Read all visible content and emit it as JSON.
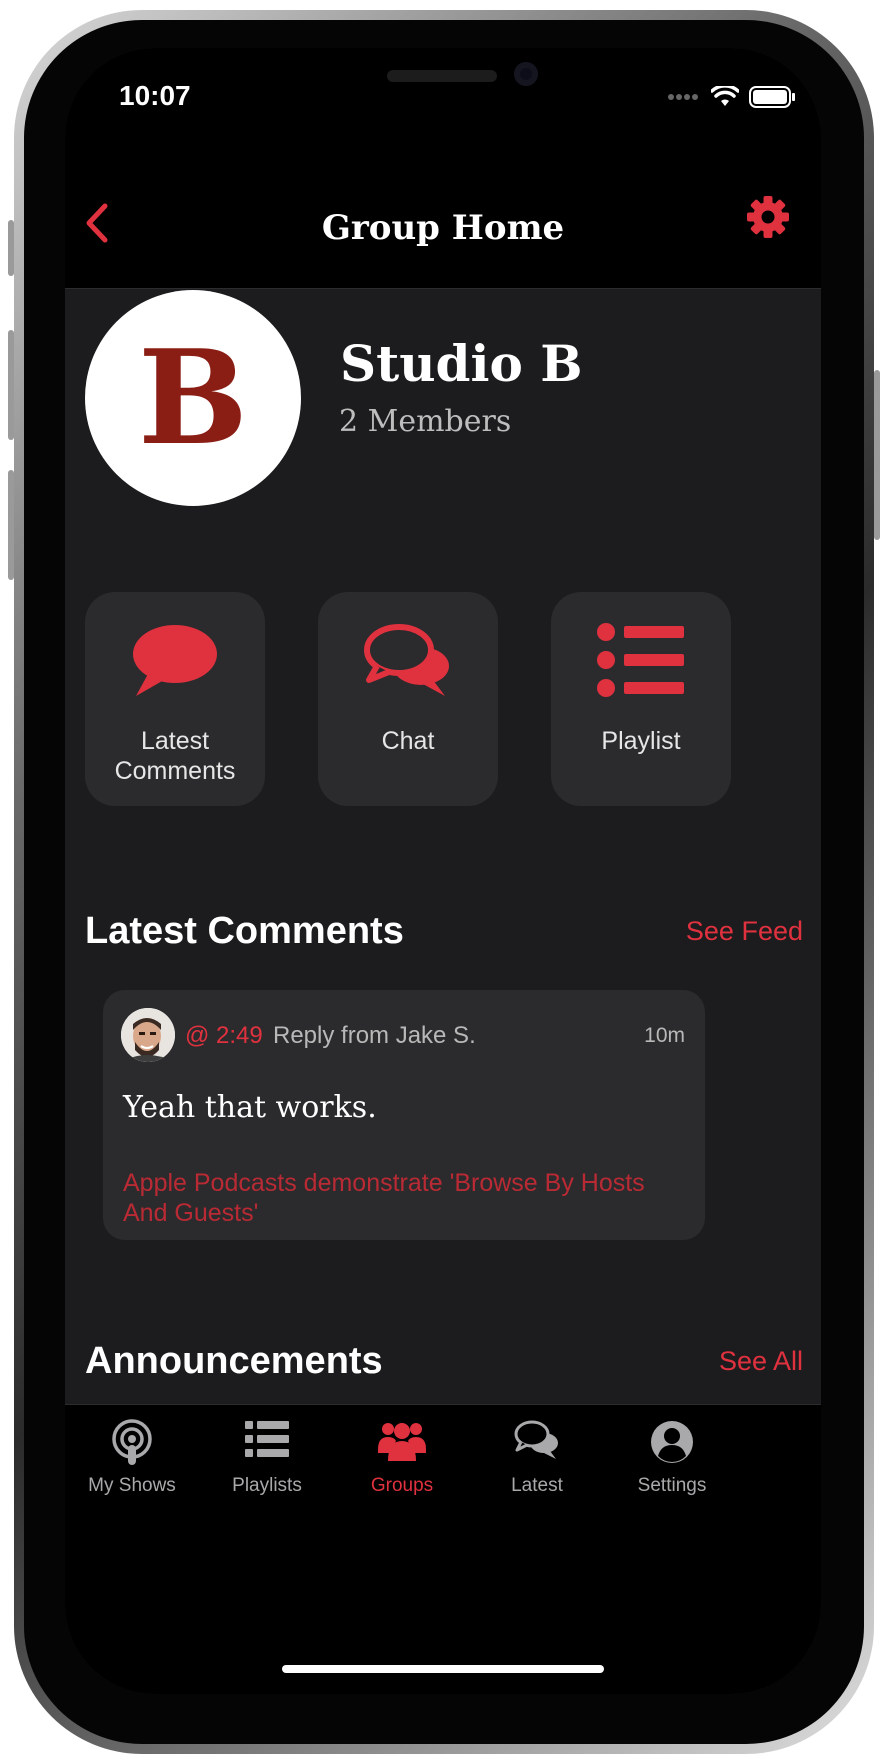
{
  "status_bar": {
    "time": "10:07"
  },
  "nav": {
    "title": "Group Home",
    "back_icon": "chevron-left-icon",
    "settings_icon": "gear-icon"
  },
  "group": {
    "avatar_letter": "B",
    "name": "Studio B",
    "members": "2 Members"
  },
  "tiles": [
    {
      "label_line1": "Latest",
      "label_line2": "Comments",
      "icon": "speech-bubble-icon"
    },
    {
      "label_line1": "Chat",
      "label_line2": "",
      "icon": "chat-bubbles-icon"
    },
    {
      "label_line1": "Playlist",
      "label_line2": "",
      "icon": "list-icon"
    }
  ],
  "latest_comments": {
    "title": "Latest Comments",
    "link": "See Feed",
    "comment": {
      "timestamp": "@ 2:49",
      "from": "Reply from Jake S.",
      "ago": "10m",
      "text": "Yeah that works.",
      "episode": "Apple Podcasts demonstrate 'Browse By Hosts And Guests'"
    }
  },
  "announcements": {
    "title": "Announcements",
    "link": "See All"
  },
  "tab_bar": {
    "tabs": [
      {
        "label": "My Shows",
        "icon": "podcast-icon",
        "active": false
      },
      {
        "label": "Playlists",
        "icon": "list-icon",
        "active": false
      },
      {
        "label": "Groups",
        "icon": "group-icon",
        "active": true
      },
      {
        "label": "Latest",
        "icon": "chat-bubbles-icon",
        "active": false
      },
      {
        "label": "Settings",
        "icon": "user-circle-icon",
        "active": false
      }
    ]
  },
  "colors": {
    "accent": "#e0313f",
    "background": "#1c1c1e",
    "tile": "#2b2b2d",
    "avatar_letter": "#8b1e14"
  }
}
